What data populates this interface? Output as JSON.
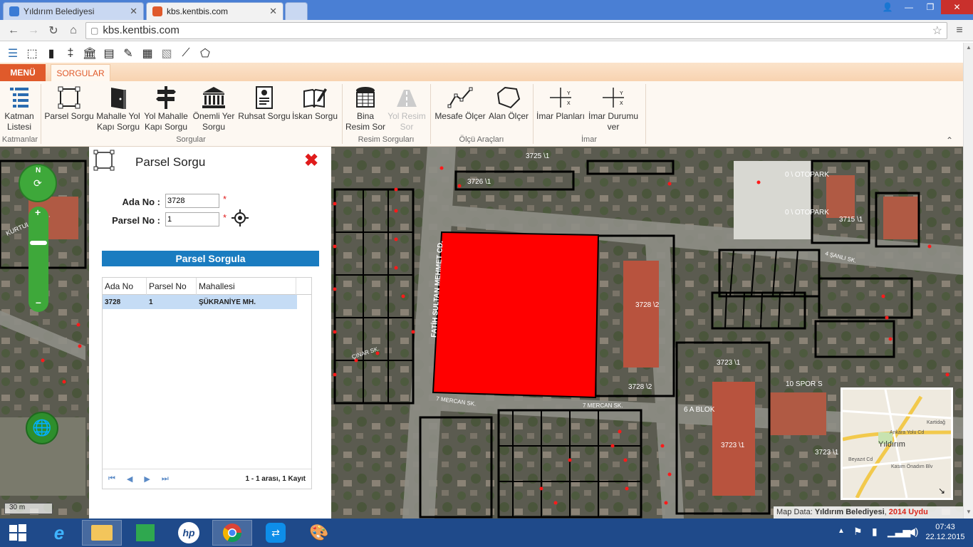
{
  "browser": {
    "tabs": [
      {
        "title": "Yıldırım Belediyesi",
        "active": false
      },
      {
        "title": "kbs.kentbis.com",
        "active": true
      }
    ],
    "url": "kbs.kentbis.com"
  },
  "app": {
    "menu_label": "MENÜ",
    "active_tab": "SORGULAR",
    "ribbon": {
      "groups": [
        {
          "name": "Katmanlar",
          "buttons": [
            {
              "label": "Katman Listesi",
              "icon": "layers-list-icon"
            }
          ]
        },
        {
          "name": "Sorgular",
          "buttons": [
            {
              "label": "Parsel Sorgu",
              "icon": "parcel-select-icon"
            },
            {
              "label": "Mahalle Yol Kapı Sorgu",
              "icon": "door-icon"
            },
            {
              "label": "Yol Mahalle Kapı Sorgu",
              "icon": "signpost-icon"
            },
            {
              "label": "Önemli Yer Sorgu",
              "icon": "landmark-icon"
            },
            {
              "label": "Ruhsat Sorgu",
              "icon": "license-doc-icon"
            },
            {
              "label": "İskan Sorgu",
              "icon": "book-pen-icon"
            }
          ]
        },
        {
          "name": "Resim Sorguları",
          "buttons": [
            {
              "label": "Bina Resim Sor",
              "icon": "building-image-icon"
            },
            {
              "label": "Yol Resim Sor",
              "icon": "road-image-icon",
              "disabled": true
            }
          ]
        },
        {
          "name": "Ölçü Araçları",
          "buttons": [
            {
              "label": "Mesafe Ölçer",
              "icon": "distance-measure-icon"
            },
            {
              "label": "Alan Ölçer",
              "icon": "area-measure-icon"
            }
          ]
        },
        {
          "name": "İmar",
          "buttons": [
            {
              "label": "İmar Planları",
              "icon": "zoning-plan-icon"
            },
            {
              "label": "İmar Durumu ver",
              "icon": "zoning-status-icon"
            }
          ]
        }
      ]
    }
  },
  "panel": {
    "title": "Parsel Sorgu",
    "ada_label": "Ada No :",
    "ada_value": "3728",
    "parsel_label": "Parsel No :",
    "parsel_value": "1",
    "required_mark": "*",
    "submit_label": "Parsel Sorgula",
    "columns": [
      "Ada No",
      "Parsel No",
      "Mahallesi"
    ],
    "rows": [
      [
        "3728",
        "1",
        "ŞÜKRANİYE MH."
      ]
    ],
    "paging_text": "1 - 1 arası, 1 Kayıt"
  },
  "map": {
    "scale_label": "30 m",
    "attribution_prefix": "Map Data: ",
    "attribution_owner": "Yıldırım Belediyesi",
    "attribution_sep": ", ",
    "attribution_year": "2014 Uydu",
    "highlight_color": "#ff0000",
    "parcel_labels": [
      "3728 \\2",
      "3728 \\2",
      "3725 \\1",
      "3723 \\1",
      "3723 \\1",
      "3723 \\1",
      "3715 \\1",
      "3726 \\1",
      "0 \\ OTOPARK",
      "0 \\ OTOPARK",
      "6 A BLOK",
      "10 SPOR S"
    ],
    "street_labels": [
      "FATİH SULTAN MEHMET CD.",
      "7 MERCAN SK.",
      "7 MERCAN SK.",
      "4 ŞANLI SK.",
      "KURTULUŞ CD.",
      "ÇINAR SK."
    ],
    "minimap_labels": [
      "Yıldırım",
      "Ankara Yolu Cd",
      "Kasım Önadım Blv",
      "Kartidağ",
      "Beyazıt Cd"
    ]
  },
  "taskbar": {
    "time": "07:43",
    "date": "22.12.2015"
  }
}
